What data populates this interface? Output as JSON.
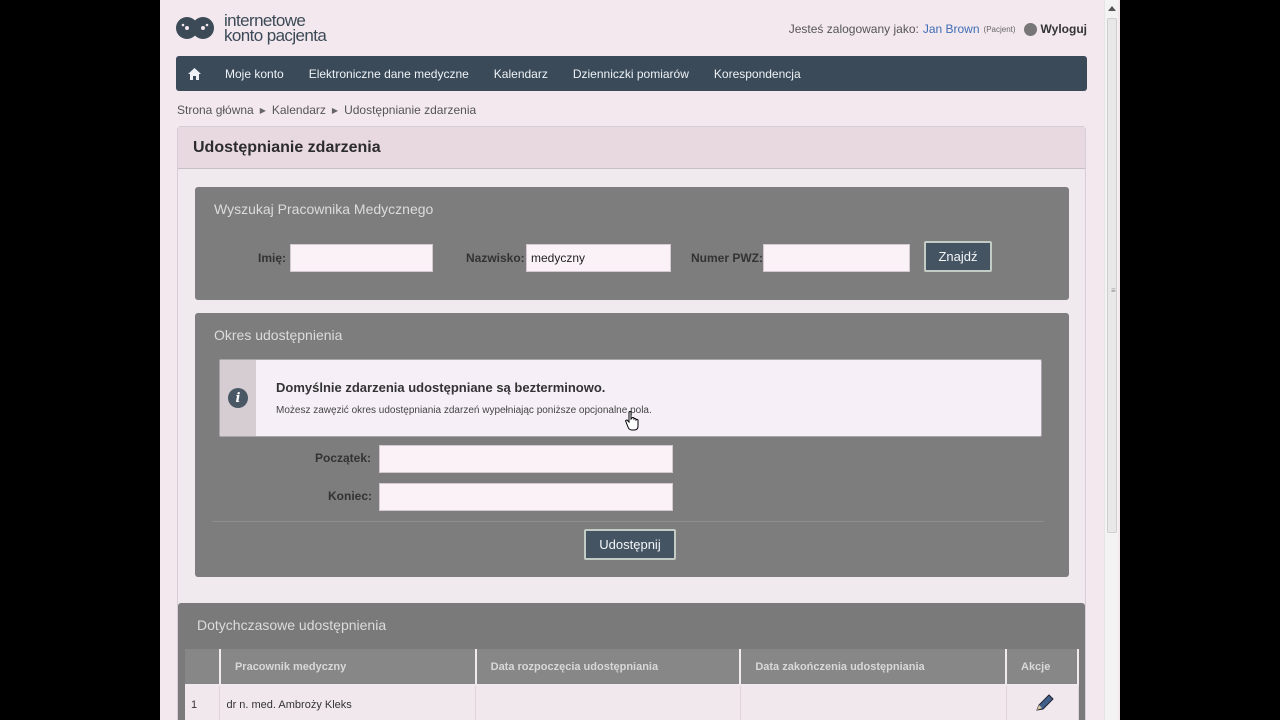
{
  "header": {
    "logo_line1": "internetowe",
    "logo_line2": "konto pacjenta",
    "logged_as_prefix": "Jesteś zalogowany jako:",
    "user_name": "Jan Brown",
    "user_role": "(Pacjent)",
    "logout_label": "Wyloguj"
  },
  "nav": {
    "items": [
      {
        "label": "Moje konto"
      },
      {
        "label": "Elektroniczne dane medyczne"
      },
      {
        "label": "Kalendarz"
      },
      {
        "label": "Dzienniczki pomiarów"
      },
      {
        "label": "Korespondencja"
      }
    ]
  },
  "breadcrumb": [
    "Strona główna",
    "Kalendarz",
    "Udostępnianie zdarzenia"
  ],
  "page_title": "Udostępnianie zdarzenia",
  "search": {
    "heading": "Wyszukaj Pracownika Medycznego",
    "first_name_label": "Imię:",
    "first_name_value": "",
    "last_name_label": "Nazwisko:",
    "last_name_value": "medyczny",
    "pwz_label": "Numer PWZ:",
    "pwz_value": "",
    "find_button": "Znajdź"
  },
  "period": {
    "heading": "Okres udostępnienia",
    "info_title": "Domyślnie zdarzenia udostępniane są bezterminowo.",
    "info_text": "Możesz zawęzić okres udostępniania zdarzeń wypełniając poniższe opcjonalne pola.",
    "start_label": "Początek:",
    "start_value": "",
    "end_label": "Koniec:",
    "end_value": "",
    "share_button": "Udostępnij"
  },
  "history": {
    "heading": "Dotychczasowe udostępnienia",
    "columns": [
      "",
      "Pracownik medyczny",
      "Data rozpoczęcia udostępniania",
      "Data zakończenia udostępniania",
      "Akcje"
    ],
    "rows": [
      {
        "index": "1",
        "worker": "dr n. med.  Ambroży  Kleks",
        "start": "",
        "end": ""
      }
    ]
  },
  "colors": {
    "nav_bg": "#3a4a58",
    "button_bg": "#445463",
    "link": "#3f6db4"
  }
}
